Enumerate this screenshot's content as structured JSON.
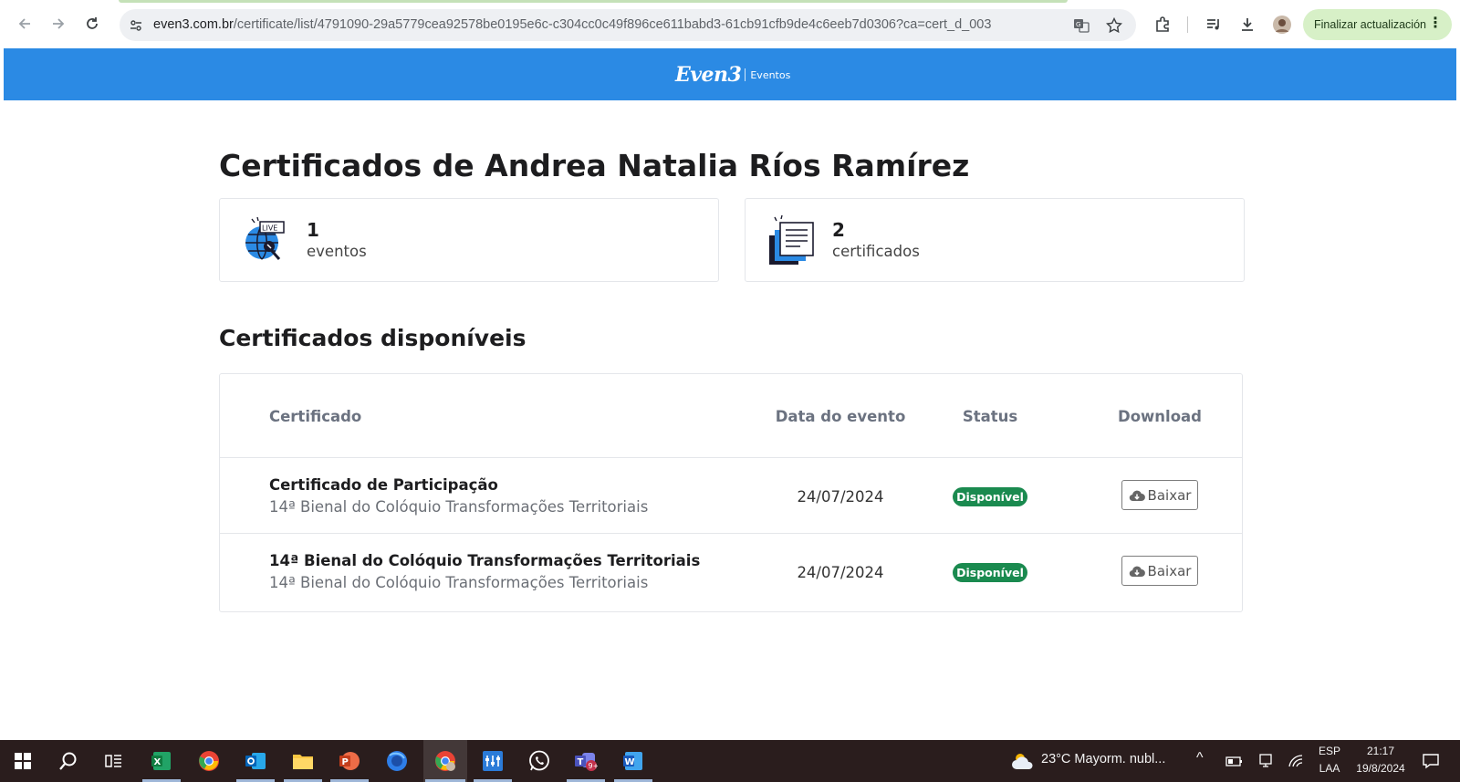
{
  "browser": {
    "url_host": "even3.com.br",
    "url_path": "/certificate/list/4791090-29a5779cea92578be0195e6c-c304cc0c49f896ce611babd3-61cb91cfb9de4c6eeb7d0306?ca=cert_d_003",
    "update_button_label": "Finalizar actualización"
  },
  "site": {
    "logo_text": "Even3",
    "logo_sub": "Eventos",
    "header_color": "#2b8ae4"
  },
  "page": {
    "title": "Certificados de Andrea Natalia Ríos Ramírez",
    "stats": [
      {
        "value": "1",
        "label": "eventos",
        "icon": "live-globe-icon"
      },
      {
        "value": "2",
        "label": "certificados",
        "icon": "documents-stack-icon"
      }
    ],
    "section_title": "Certificados disponíveis",
    "table": {
      "headers": {
        "certificate": "Certificado",
        "date": "Data do evento",
        "status": "Status",
        "download": "Download"
      },
      "rows": [
        {
          "title": "Certificado de Participação",
          "event": "14ª Bienal do Colóquio Transformações Territoriais",
          "date": "24/07/2024",
          "status": "Disponível",
          "action": "Baixar"
        },
        {
          "title": "14ª Bienal do Colóquio Transformações Territoriais",
          "event": "14ª Bienal do Colóquio Transformações Territoriais",
          "date": "24/07/2024",
          "status": "Disponível",
          "action": "Baixar"
        }
      ],
      "status_color": "#1a8a4f"
    }
  },
  "taskbar": {
    "weather": "23°C  Mayorm. nubl...",
    "lang_top": "ESP",
    "lang_bottom": "LAA",
    "time": "21:17",
    "date": "19/8/2024"
  }
}
